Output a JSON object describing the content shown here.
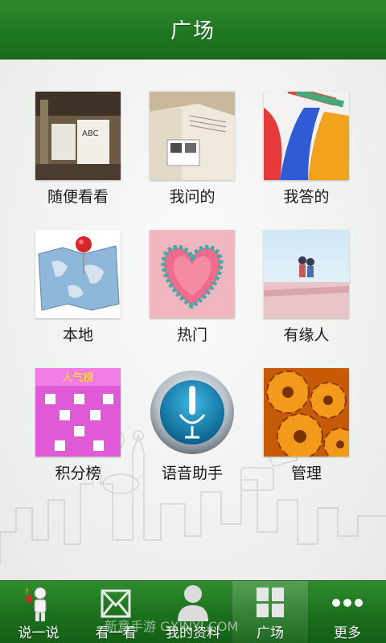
{
  "header": {
    "title": "广场"
  },
  "grid": {
    "items": [
      {
        "label": "随便看看",
        "icon": "bookstore-photo-icon"
      },
      {
        "label": "我问的",
        "icon": "open-book-photo-icon"
      },
      {
        "label": "我答的",
        "icon": "colored-pencils-icon"
      },
      {
        "label": "本地",
        "icon": "map-pin-icon"
      },
      {
        "label": "热门",
        "icon": "matchstick-heart-icon"
      },
      {
        "label": "有缘人",
        "icon": "couple-photo-icon"
      },
      {
        "label": "积分榜",
        "icon": "leaderboard-icon",
        "thumb_text": "人气榜"
      },
      {
        "label": "语音助手",
        "icon": "microphone-icon"
      },
      {
        "label": "管理",
        "icon": "gears-icon"
      }
    ]
  },
  "tabbar": {
    "tabs": [
      {
        "label": "说一说",
        "icon": "speaker-person-icon"
      },
      {
        "label": "看一看",
        "icon": "envelope-icon"
      },
      {
        "label": "我的资料",
        "icon": "profile-icon"
      },
      {
        "label": "广场",
        "icon": "grid-icon",
        "active": true
      },
      {
        "label": "更多",
        "icon": "more-dots-icon"
      }
    ]
  },
  "watermark": {
    "text": "新意手游 GXINYI.COM"
  },
  "colors": {
    "header": "#1f7620",
    "tabbar": "#1c701d",
    "background": "#f2f3f2"
  }
}
